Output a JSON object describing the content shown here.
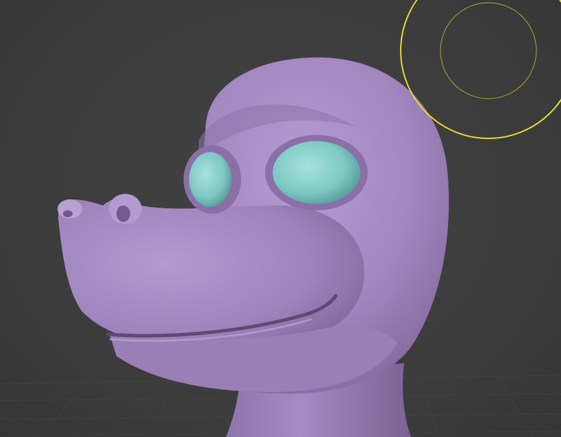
{
  "app": {
    "name": "",
    "viewport": {
      "background_color": "#3d3d3d",
      "grid_visible": true,
      "grid_color": "#4a4a4a"
    }
  },
  "model": {
    "subject": "sculpted-creature-head",
    "skin_color": "#a386c0",
    "eye_color": "#7fc8c4",
    "shading": "matcap-solid"
  },
  "brush": {
    "outline_color": "#e5dc2a",
    "shape": "circle",
    "falloff_ring_visible": true
  }
}
